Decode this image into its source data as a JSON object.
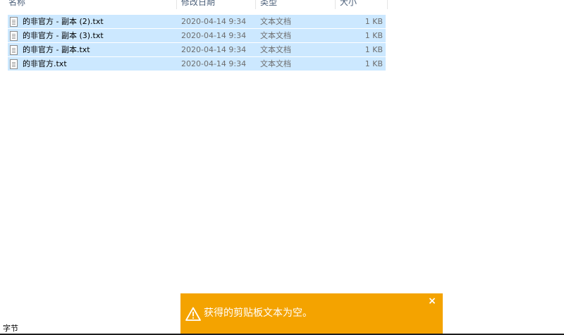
{
  "columns": {
    "name": "名称",
    "modified": "修改日期",
    "type": "类型",
    "size": "大小"
  },
  "files": [
    {
      "name": "的非官方 - 副本 (2).txt",
      "modified": "2020-04-14 9:34",
      "type": "文本文档",
      "size": "1 KB",
      "icon": "text-file-icon",
      "selected": true
    },
    {
      "name": "的非官方 - 副本 (3).txt",
      "modified": "2020-04-14 9:34",
      "type": "文本文档",
      "size": "1 KB",
      "icon": "text-file-icon",
      "selected": true
    },
    {
      "name": "的非官方 - 副本.txt",
      "modified": "2020-04-14 9:34",
      "type": "文本文档",
      "size": "1 KB",
      "icon": "text-file-icon",
      "selected": true
    },
    {
      "name": "的非官方.txt",
      "modified": "2020-04-14 9:34",
      "type": "文本文档",
      "size": "1 KB",
      "icon": "text-file-icon",
      "selected": true
    }
  ],
  "status_bar": {
    "text": "字节"
  },
  "toast": {
    "message": "获得的剪贴板文本为空。",
    "close_label": "×",
    "icon": "warning-icon",
    "background": "#f4a300"
  },
  "colors": {
    "selection": "#cce8ff",
    "header_text": "#4c607a",
    "secondary_text": "#6d6d6d"
  }
}
